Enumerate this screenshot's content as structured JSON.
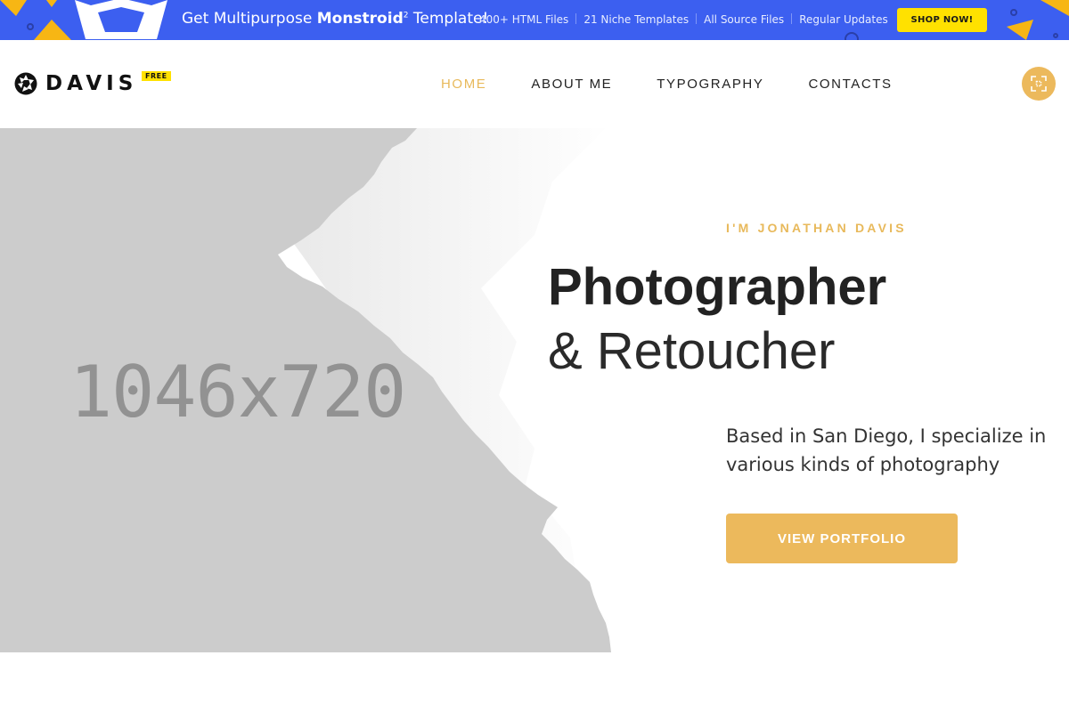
{
  "promo": {
    "headline_pre": "Get Multipurpose ",
    "headline_bold": "Monstroid",
    "headline_sup": "2",
    "headline_post": " Template!",
    "features": [
      "400+ HTML Files",
      "21 Niche Templates",
      "All Source Files",
      "Regular Updates"
    ],
    "cta_label": "SHOP NOW!",
    "colors": {
      "background": "#3c5ff0",
      "cta": "#ffe100",
      "accent_shapes": "#f7b614"
    }
  },
  "header": {
    "brand_name": "DAVIS",
    "brand_badge": "FREE",
    "brand_icon": "camera-aperture-icon",
    "nav": [
      {
        "label": "HOME",
        "active": true
      },
      {
        "label": "ABOUT ME",
        "active": false
      },
      {
        "label": "TYPOGRAPHY",
        "active": false
      },
      {
        "label": "CONTACTS",
        "active": false
      }
    ],
    "fullscreen_icon": "fullscreen-icon",
    "colors": {
      "accent": "#e8b95b"
    }
  },
  "hero": {
    "image_placeholder": "1046x720",
    "eyebrow": "I'M JONATHAN DAVIS",
    "title_main": "Photographer",
    "title_sub": "& Retoucher",
    "blurb": "Based in San Diego, I specialize in various kinds of photography",
    "cta_label": "VIEW PORTFOLIO",
    "colors": {
      "placeholder_bg": "#cccccc",
      "button": "#ecb95c"
    }
  }
}
